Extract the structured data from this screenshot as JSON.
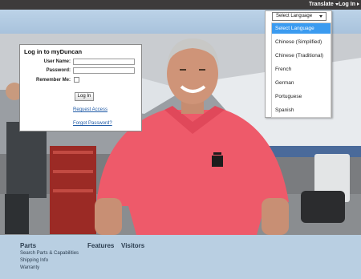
{
  "topbar": {
    "translate_label": "Translate",
    "login_label": "Log In"
  },
  "colors": {
    "topbar": "#3d3b3b",
    "header_band": "#bcd3e8",
    "footer": "#b9cfe2",
    "link": "#1f5aa6",
    "selected_option": "#3b9bf0"
  },
  "login_panel": {
    "title": "Log in to myDuncan",
    "username_label": "User Name:",
    "username_value": "",
    "password_label": "Password:",
    "password_value": "",
    "remember_label": "Remember Me:",
    "remember_checked": false,
    "login_button": "Log In",
    "request_access": "Request Access",
    "forgot_password": "Forgot Password?"
  },
  "language": {
    "selected_value": "Select Language",
    "options": [
      "Select Language",
      "Chinese (Simplified)",
      "Chinese (Traditional)",
      "French",
      "German",
      "Portuguese",
      "Spanish"
    ],
    "highlighted_index": 0
  },
  "footer": {
    "parts_heading": "Parts",
    "features_heading": "Features",
    "visitors_heading": "Visitors",
    "parts_links": [
      "Search Parts & Capabilities",
      "Shipping Info",
      "Warranty"
    ]
  },
  "hero": {
    "description_icon": "photo-smiling-man-pink-polo-hangar"
  }
}
